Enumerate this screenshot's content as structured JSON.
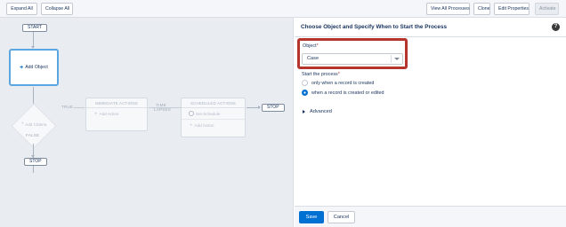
{
  "toolbar": {
    "expand_all": "Expand All",
    "collapse_all": "Collapse All",
    "view_all_processes": "View All Processes",
    "clone": "Clone",
    "edit_properties": "Edit Properties",
    "activate": "Activate"
  },
  "canvas": {
    "start": "START",
    "add_object": "Add Object",
    "add_criteria": "Add Criteria",
    "true_label": "TRUE",
    "false_label": "FALSE",
    "immediate_actions": "IMMEDIATE ACTIONS",
    "add_action_1": "Add Action",
    "time_lapses": "TIME LAPSES",
    "scheduled_actions": "SCHEDULED ACTIONS",
    "set_schedule": "Set Schedule",
    "add_action_2": "Add Action",
    "stop_right": "STOP",
    "stop_bottom": "STOP"
  },
  "panel": {
    "title": "Choose Object and Specify When to Start the Process",
    "help_icon": "?",
    "object_label": "Object",
    "required_mark": "*",
    "object_value": "Case",
    "start_label": "Start the process",
    "option_1": "only when a record is created",
    "option_2": "when a record is created or edited",
    "selected_option": "when a record is created or edited",
    "advanced": "Advanced",
    "save": "Save",
    "cancel": "Cancel"
  },
  "colors": {
    "accent": "#0070d2",
    "highlight": "#b5342c",
    "selected_node_border": "#5aa6e0"
  }
}
